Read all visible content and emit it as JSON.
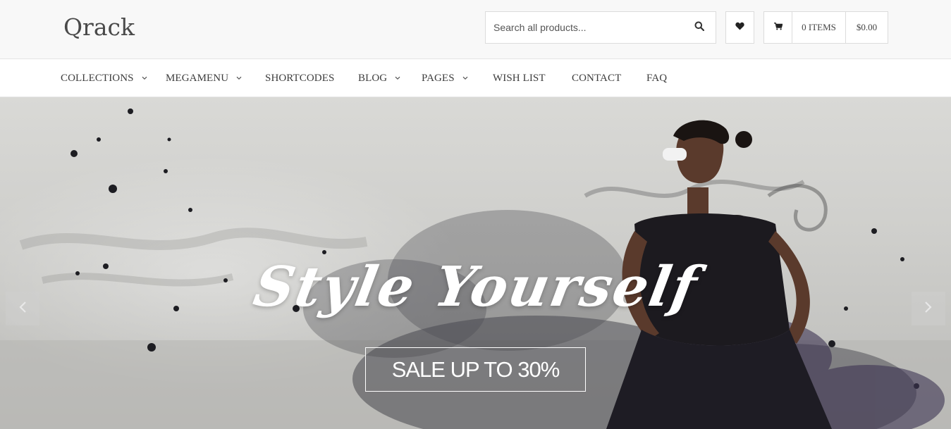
{
  "header": {
    "logo_text": "Qrack",
    "search": {
      "placeholder": "Search all products...",
      "icon": "search-icon"
    },
    "wishlist": {
      "icon": "heart-icon"
    },
    "cart": {
      "icon": "cart-icon",
      "items": "0 ITEMS",
      "total": "$0.00"
    }
  },
  "nav": {
    "items": [
      {
        "label": "COLLECTIONS",
        "has_dropdown": true
      },
      {
        "label": "MEGAMENU",
        "has_dropdown": true
      },
      {
        "label": "SHORTCODES",
        "has_dropdown": false
      },
      {
        "label": "BLOG",
        "has_dropdown": true
      },
      {
        "label": "PAGES",
        "has_dropdown": true
      },
      {
        "label": "WISH LIST",
        "has_dropdown": false
      },
      {
        "label": "CONTACT",
        "has_dropdown": false
      },
      {
        "label": "FAQ",
        "has_dropdown": false
      }
    ]
  },
  "hero": {
    "headline": "Style Yourself",
    "cta": "SALE UP TO 30%",
    "prev_icon": "chevron-left-icon",
    "next_icon": "chevron-right-icon"
  },
  "colors": {
    "header_bg": "#f8f8f8",
    "nav_text": "#3d3d3d",
    "hero_text": "#ffffff"
  }
}
